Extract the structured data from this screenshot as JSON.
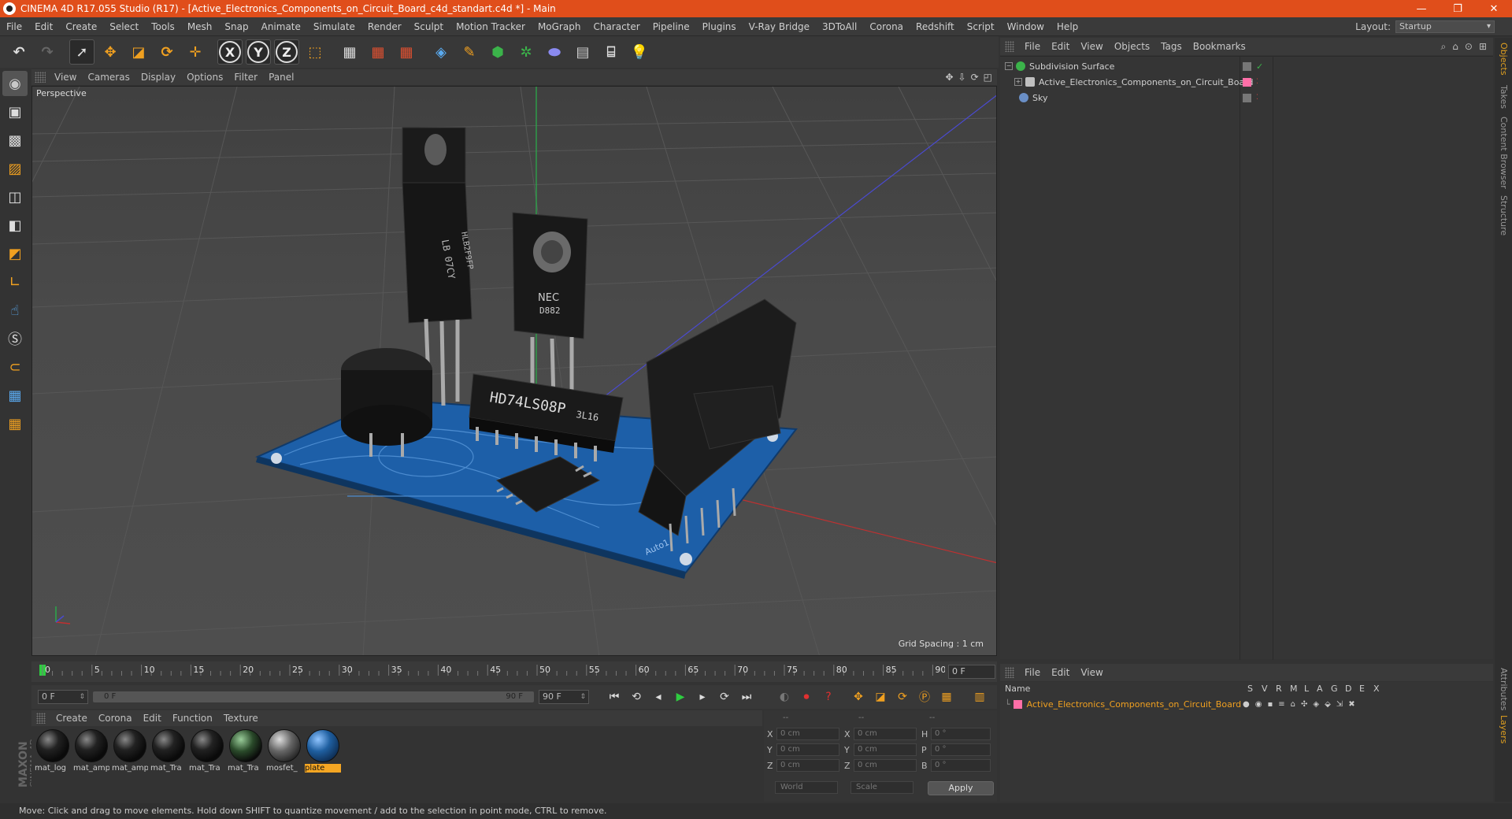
{
  "window": {
    "title": "CINEMA 4D R17.055 Studio (R17) - [Active_Electronics_Components_on_Circuit_Board_c4d_standart.c4d *] - Main",
    "controls": [
      "—",
      "❐",
      "✕"
    ]
  },
  "menubar": {
    "items": [
      "File",
      "Edit",
      "Create",
      "Select",
      "Tools",
      "Mesh",
      "Snap",
      "Animate",
      "Simulate",
      "Render",
      "Sculpt",
      "Motion Tracker",
      "MoGraph",
      "Character",
      "Pipeline",
      "Plugins",
      "V-Ray Bridge",
      "3DToAll",
      "Corona",
      "Redshift",
      "Script",
      "Window",
      "Help"
    ],
    "layout_label": "Layout:",
    "layout_value": "Startup"
  },
  "toolbar": {
    "icons": [
      "undo-icon",
      "redo-icon",
      "select-arrow-icon",
      "move-icon",
      "scale-icon",
      "rotate-icon",
      "live-move-icon",
      "x-axis-icon",
      "y-axis-icon",
      "z-axis-icon",
      "world-coords-icon",
      "render-view-icon",
      "render-picture-icon",
      "render-settings-icon",
      "cube-icon",
      "pen-icon",
      "subdivision-icon",
      "array-icon",
      "deformer-icon",
      "floor-icon",
      "camera-icon",
      "light-icon"
    ],
    "axis_labels": [
      "X",
      "Y",
      "Z"
    ]
  },
  "viewport": {
    "menu": [
      "View",
      "Cameras",
      "Display",
      "Options",
      "Filter",
      "Panel"
    ],
    "label": "Perspective",
    "grid_spacing": "Grid Spacing : 1 cm",
    "chip_texts": [
      "HD74LS08P",
      "3L16",
      "NEC",
      "D882",
      "LB 07CY",
      "HLB2F9FP"
    ],
    "board_texts": [
      "Auto1"
    ]
  },
  "timeline": {
    "ticks": [
      "0",
      "5",
      "10",
      "15",
      "20",
      "25",
      "30",
      "35",
      "40",
      "45",
      "50",
      "55",
      "60",
      "65",
      "70",
      "75",
      "80",
      "85",
      "90"
    ],
    "current_frame": "0 F",
    "start_field": "0 F",
    "range_start": "0 F",
    "range_end": "90 F",
    "end_field": "90 F"
  },
  "materials": {
    "menu": [
      "Create",
      "Corona",
      "Edit",
      "Function",
      "Texture"
    ],
    "items": [
      {
        "name": "mat_log"
      },
      {
        "name": "mat_amp"
      },
      {
        "name": "mat_amp"
      },
      {
        "name": "mat_Tra"
      },
      {
        "name": "mat_Tra"
      },
      {
        "name": "mat_Tra"
      },
      {
        "name": "mosfet_"
      },
      {
        "name": "plate"
      }
    ]
  },
  "coordinates": {
    "headers": [
      "--",
      "--",
      "--"
    ],
    "rows": [
      {
        "a": "X",
        "v1": "0 cm",
        "b": "X",
        "v2": "0 cm",
        "c": "H",
        "v3": "0 °"
      },
      {
        "a": "Y",
        "v1": "0 cm",
        "b": "Y",
        "v2": "0 cm",
        "c": "P",
        "v3": "0 °"
      },
      {
        "a": "Z",
        "v1": "0 cm",
        "b": "Z",
        "v2": "0 cm",
        "c": "B",
        "v3": "0 °"
      }
    ],
    "mode": "World",
    "size_mode": "Scale",
    "apply_label": "Apply"
  },
  "objects": {
    "menu": [
      "File",
      "Edit",
      "View",
      "Objects",
      "Tags",
      "Bookmarks"
    ],
    "items": [
      {
        "name": "Subdivision Surface",
        "icon_color": "#3bb34a",
        "expand": "−"
      },
      {
        "name": "Active_Electronics_Components_on_Circuit_Board",
        "icon_color": "#c0c0c0",
        "expand": "+",
        "tag_color": "#ff6fa8"
      },
      {
        "name": "Sky",
        "icon_color": "#6a8fc6",
        "expand": ""
      }
    ]
  },
  "side_tabs": [
    "Objects",
    "Takes",
    "Content Browser",
    "Structure",
    "Attributes",
    "Layers"
  ],
  "layers": {
    "menu": [
      "File",
      "Edit",
      "View"
    ],
    "columns": [
      "Name",
      "S",
      "V",
      "R",
      "M",
      "L",
      "A",
      "G",
      "D",
      "E",
      "X"
    ],
    "rows": [
      {
        "name": "Active_Electronics_Components_on_Circuit_Board",
        "color": "#ff6fa8"
      }
    ]
  },
  "status": {
    "text": "Move: Click and drag to move elements. Hold down SHIFT to quantize movement / add to the selection in point mode, CTRL to remove."
  },
  "brand": {
    "maxon": "MAXON",
    "product": "CINEMA 4D"
  },
  "colors": {
    "titlebar": "#e04e1b",
    "accent": "#f5a623",
    "board": "#1d5fa8"
  }
}
